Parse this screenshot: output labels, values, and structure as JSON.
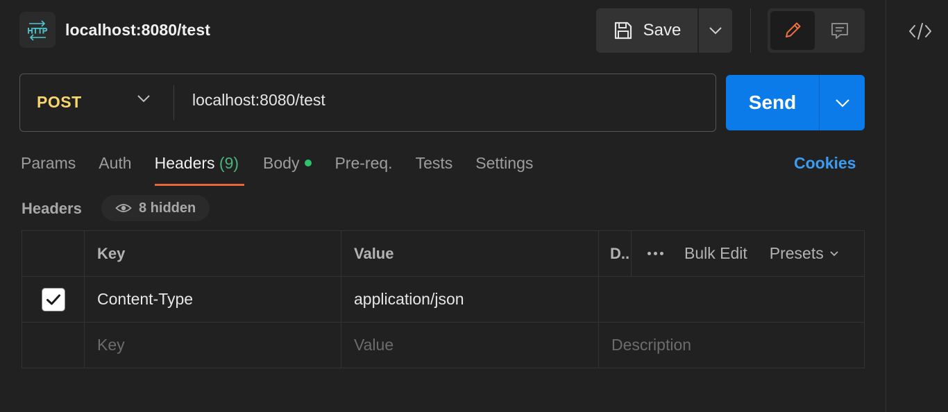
{
  "request": {
    "title": "localhost:8080/test",
    "icon": "http-icon"
  },
  "toolbar": {
    "save_label": "Save"
  },
  "url_bar": {
    "method": "POST",
    "url": "localhost:8080/test",
    "send_label": "Send"
  },
  "tabs": [
    {
      "label": "Params"
    },
    {
      "label": "Auth"
    },
    {
      "label": "Headers",
      "count": "(9)"
    },
    {
      "label": "Body"
    },
    {
      "label": "Pre-req."
    },
    {
      "label": "Tests"
    },
    {
      "label": "Settings"
    }
  ],
  "cookies_label": "Cookies",
  "headers_section": {
    "label": "Headers",
    "hidden_label": "8 hidden"
  },
  "table": {
    "columns": {
      "key": "Key",
      "value": "Value",
      "description": "D.."
    },
    "bulk_edit": "Bulk Edit",
    "presets": "Presets",
    "rows": [
      {
        "key": "Content-Type",
        "value": "application/json",
        "description": "",
        "checked": true
      }
    ],
    "placeholder": {
      "key": "Key",
      "value": "Value",
      "description": "Description"
    }
  },
  "colors": {
    "accent": "#0b7bea",
    "method": "#f8d66d",
    "tab_underline": "#e8643b",
    "count": "#49b57b",
    "body_dot": "#2bc36b",
    "cookies": "#3b9cf2"
  }
}
